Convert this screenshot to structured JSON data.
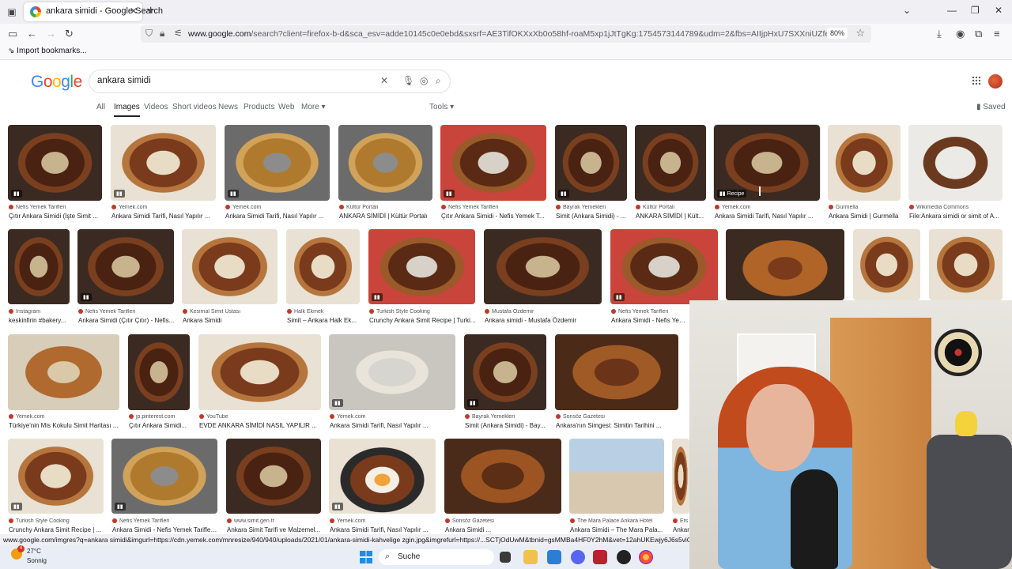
{
  "browser": {
    "tab_title": "ankara simidi - Google Search",
    "url_host": "www.google.com",
    "url_rest": "/search?client=firefox-b-d&sca_esv=adde10145c0e0ebd&sxsrf=AE3TifOKXxXb0o58hf-roaM5xp1jJtTgKg:1754573144789&udm=2&fbs=AIIjpHxU7SXXniUZfeShr2fp4giZ1Y6MJ25_tmWI",
    "zoom": "80%",
    "bookmarks_label": "Import bookmarks..."
  },
  "google": {
    "logo": [
      "G",
      "o",
      "o",
      "g",
      "l",
      "e"
    ],
    "query": "ankara simidi",
    "tabs": [
      "All",
      "Images",
      "Videos",
      "Short videos",
      "News",
      "Products",
      "Web",
      "More ▾"
    ],
    "tools": "Tools ▾",
    "saved": "Saved"
  },
  "results": [
    {
      "src": "Nefis Yemek Tarifleri",
      "cap": "Çıtır Ankara Simidi (İşte Simit ..."
    },
    {
      "src": "Yemek.com",
      "cap": "Ankara Simidi Tarifi, Nasıl Yapılır ..."
    },
    {
      "src": "Yemek.com",
      "cap": "Ankara Simidi Tarifi, Nasıl Yapılır ..."
    },
    {
      "src": "Kültür Portalı",
      "cap": "ANKARA SİMİDİ | Kültür Portalı"
    },
    {
      "src": "Nefis Yemek Tarifleri",
      "cap": "Çıtır Ankara Simidi - Nefis Yemek T..."
    },
    {
      "src": "Bayrak Yemekleri",
      "cap": "Simit (Ankara Simidi) - ..."
    },
    {
      "src": "Kültür Portalı",
      "cap": "ANKARA SİMİDİ | Kült..."
    },
    {
      "src": "Yemek.com",
      "cap": "Ankara Simidi Tarifi, Nasıl Yapılır ...",
      "badge": "Recipe"
    },
    {
      "src": "Gurmella",
      "cap": "Ankara Simidi | Gurmella"
    },
    {
      "src": "Wikimedia Commons",
      "cap": "File:Ankara simidi or simit of A..."
    },
    {
      "src": "Instagram",
      "cap": "keskinfirin #bakery..."
    },
    {
      "src": "Nefis Yemek Tarifleri",
      "cap": "Ankara Simidi (Çıtır Çıtır) - Nefis..."
    },
    {
      "src": "Kesimal Simit Ustası",
      "cap": "Ankara Simidi"
    },
    {
      "src": "Halk Ekmek",
      "cap": "Simit – Ankara Halk Ek..."
    },
    {
      "src": "Turkish Style Cooking",
      "cap": "Crunchy Ankara Simit Recipe | Turki..."
    },
    {
      "src": "Mustafa Özdemir",
      "cap": "Ankara simidi - Mustafa Özdemir"
    },
    {
      "src": "Nefis Yemek Tarifleri",
      "cap": "Ankara Simidi - Nefis Yemek T..."
    },
    {
      "src": "",
      "cap": ""
    },
    {
      "src": "",
      "cap": ""
    },
    {
      "src": "",
      "cap": ""
    },
    {
      "src": "Yemek.com",
      "cap": "Türkiye'nin Mis Kokulu Simit Haritası ..."
    },
    {
      "src": "jp.pinterest.com",
      "cap": "Çıtır Ankara Simidi..."
    },
    {
      "src": "YouTube",
      "cap": "EVDE ANKARA SİMİDİ NASIL YAPILIR ..."
    },
    {
      "src": "Yemek.com",
      "cap": "Ankara Simidi Tarifi, Nasıl Yapılır ..."
    },
    {
      "src": "Bayrak Yemekleri",
      "cap": "Simit (Ankara Simidi) - Bay..."
    },
    {
      "src": "Sonsöz Gazetesi",
      "cap": "Ankara'nın Simgesi: Simitin Tarihini ..."
    },
    {
      "src": "Turkish Style Cooking",
      "cap": "Crunchy Ankara Simit Recipe | ..."
    },
    {
      "src": "Nefis Yemek Tarifleri",
      "cap": "Ankara Simidi - Nefis Yemek Tarifleri..."
    },
    {
      "src": "www.simit.gen.tr",
      "cap": "Ankara Simit Tarifi ve Malzemel..."
    },
    {
      "src": "Yemek.com",
      "cap": "Ankara Simidi Tarifi, Nasıl Yapılır ..."
    },
    {
      "src": "Sonsöz Gazetesi",
      "cap": "Ankara Simidi ..."
    },
    {
      "src": "The Mara Palace Ankara Hotel",
      "cap": "Ankara Simidi – The Mara Pala..."
    },
    {
      "src": "Ets",
      "cap": "Ankar"
    }
  ],
  "status_url": "www.google.com/imgres?q=ankara simidi&imgurl=https://cdn.yemek.com/mnresize/940/940/uploads/2021/01/ankara-simidi-kahvelige zgin.jpg&imgrefurl=https://...SCTjOdUwM&tbnid=gsMMBa4HF0Y2hM&vet=12ahUKEwjy6J6s5viOAxVjQPEDHR",
  "taskbar": {
    "weather_badge": "4",
    "temperature": "27°C",
    "condition": "Sonnig",
    "search_label": "Suche"
  }
}
